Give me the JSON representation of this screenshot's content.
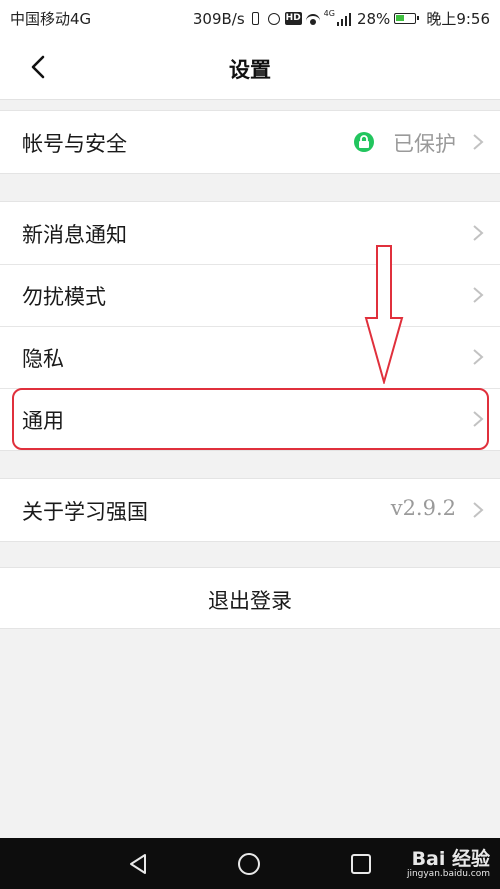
{
  "status_bar": {
    "carrier": "中国移动4G",
    "speed": "309B/s",
    "hd": "HD",
    "net_type": "4G",
    "battery": "28%",
    "time": "晚上9:56"
  },
  "nav": {
    "title": "设置"
  },
  "groups": {
    "account": {
      "label": "帐号与安全",
      "status": "已保护"
    },
    "settings_items": [
      {
        "label": "新消息通知"
      },
      {
        "label": "勿扰模式"
      },
      {
        "label": "隐私"
      },
      {
        "label": "通用"
      }
    ],
    "about": {
      "label": "关于学习强国",
      "version": "v2.9.2"
    }
  },
  "logout": {
    "label": "退出登录"
  },
  "watermark": {
    "brand": "Bai 经验",
    "url": "jingyan.baidu.com"
  },
  "colors": {
    "accent_green": "#22c55e",
    "annotation_red": "#e0303c"
  }
}
